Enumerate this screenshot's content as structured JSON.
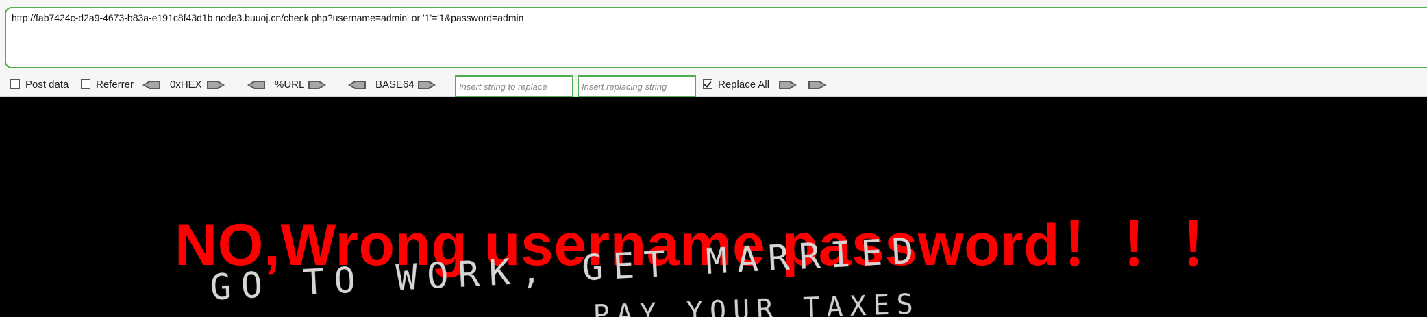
{
  "hackbar": {
    "url": "http://fab7424c-d2a9-4673-b83a-e191c8f43d1b.node3.buuoj.cn/check.php?username=admin' or '1'='1&password=admin",
    "post_data_label": "Post data",
    "referrer_label": "Referrer",
    "hex_label": "0xHEX",
    "url_enc_label": "%URL",
    "base64_label": "BASE64",
    "replace_input_placeholder": "Insert string to replace",
    "replacing_input_placeholder": "Insert replacing string",
    "replace_all_label": "Replace All",
    "post_data_checked": false,
    "referrer_checked": false,
    "replace_all_checked": true,
    "accent_color": "#4caf50"
  },
  "page": {
    "message": "NO,Wrong username password！！！",
    "background_text_line1": "GO TO WORK, GET MARRIED",
    "background_text_line2": "PAY YOUR TAXES",
    "background_color": "#000000",
    "message_color": "#ff0000"
  }
}
